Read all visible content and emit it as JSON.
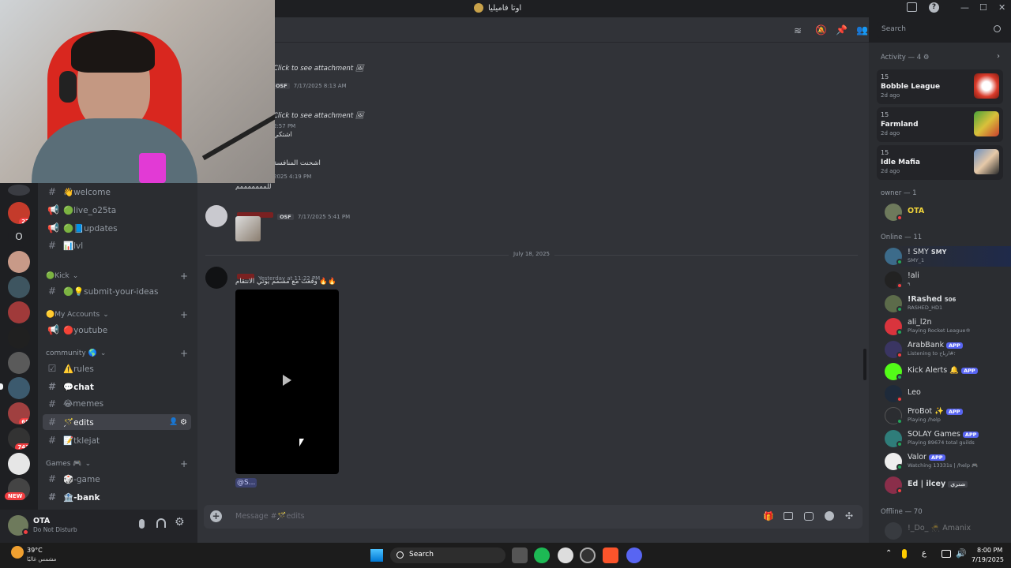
{
  "window": {
    "title": "اوتا فاميليا",
    "minimize": "—",
    "maximize": "☐",
    "close": "✕"
  },
  "colors": {
    "accent": "#5865f2",
    "online": "#23a55a",
    "dnd": "#f23f42",
    "idle": "#f0b232",
    "bg": "#313338"
  },
  "rail": {
    "badges": [
      "27",
      "65",
      "743"
    ],
    "letter_server": "O",
    "new_label": "NEW"
  },
  "sidebar": {
    "channels_top": [
      {
        "icon": "hash",
        "label": "👋welcome"
      },
      {
        "icon": "megaphone",
        "label": "🟢live_o25ta"
      },
      {
        "icon": "megaphone",
        "label": "🟢📘updates"
      },
      {
        "icon": "hash",
        "label": "📊lvl"
      }
    ],
    "categories": [
      {
        "label": "🟢Kick",
        "channels": [
          {
            "icon": "hash",
            "label": "🟢💡submit-your-ideas"
          }
        ]
      },
      {
        "label": "🟡My Accounts",
        "channels": [
          {
            "icon": "megaphone",
            "label": "🔴youtube"
          }
        ]
      },
      {
        "label": "community 🌎",
        "channels": [
          {
            "icon": "rules",
            "label": "⚠️rules"
          },
          {
            "icon": "hash",
            "label": "💬chat"
          },
          {
            "icon": "hash",
            "label": "😂memes"
          },
          {
            "icon": "hash",
            "label": "🪄edits"
          },
          {
            "icon": "hash",
            "label": "📝tklejat"
          }
        ]
      },
      {
        "label": "Games 🎮",
        "channels": [
          {
            "icon": "hash",
            "label": "🎲-game"
          },
          {
            "icon": "hash",
            "label": "🏦-bank"
          }
        ]
      }
    ]
  },
  "user": {
    "name": "OTA",
    "status": "Do Not Disturb"
  },
  "chat": {
    "messages": [
      {
        "attachment": "Click to see attachment",
        "tag": "OSF",
        "time": "7/17/2025 8:13 AM"
      },
      {
        "attachment": "Click to see attachment",
        "time": "2:57 PM",
        "text": "اشتكي"
      },
      {
        "text2": "اشحنت المنافسة",
        "time": "2025 4:19 PM",
        "text3": "للمممممممم"
      },
      {
        "tag": "OSF",
        "time": "7/17/2025 5:41 PM"
      }
    ],
    "divider": "July 18, 2025",
    "last_message": {
      "time": "Yesterday at 11:22 PM",
      "text": "وقعت مع مسمم يوتي الانتقام 🔥🔥",
      "mention": "@S..."
    },
    "composer_placeholder": "Message #🪄edits"
  },
  "header": {
    "search_placeholder": "Search"
  },
  "members": {
    "activity_header": "Activity — 4",
    "activities": [
      {
        "count": "15",
        "game": "Bobble League",
        "ago": "2d ago"
      },
      {
        "count": "15",
        "game": "Farmland",
        "ago": "2d ago"
      },
      {
        "count": "15",
        "game": "Idle Mafia",
        "ago": "2d ago"
      }
    ],
    "owner_header": "owner — 1",
    "owner": "OTA",
    "online_header": "Online — 11",
    "online": [
      {
        "name": "! SMY",
        "tag": "SMY",
        "sub": "SMY_1"
      },
      {
        "name": "!ali",
        "sub": "٩"
      },
      {
        "name": "!Rashed",
        "tag": "506",
        "sub": "RASHED_HD1"
      },
      {
        "name": "ali_l2n",
        "sub": "Playing Rocket League®"
      },
      {
        "name": "ArabBank",
        "app": "APP",
        "sub": "Listening to ؛#ارباح"
      },
      {
        "name": "Kick Alerts 🔔",
        "app": "APP",
        "sub": ""
      },
      {
        "name": "Leo",
        "sub": ""
      },
      {
        "name": "ProBot ✨",
        "app": "APP",
        "sub": "Playing /help"
      },
      {
        "name": "SOLAY Games",
        "app": "APP",
        "sub": "Playing 89674 total guilds"
      },
      {
        "name": "Valor",
        "app": "APP",
        "sub": "Watching 13331s | /help 🎮"
      },
      {
        "name": "Ed | ilcey",
        "tag": "شتري",
        "sub": ""
      }
    ],
    "offline_header": "Offline — 70",
    "offline_first": "!_Do_ 🥷 Amanix"
  },
  "taskbar": {
    "weather_temp": "39°C",
    "weather_desc": "مشمس غالبًا",
    "search": "Search",
    "lang": "ع",
    "time": "8:00 PM",
    "date": "7/19/2025"
  }
}
